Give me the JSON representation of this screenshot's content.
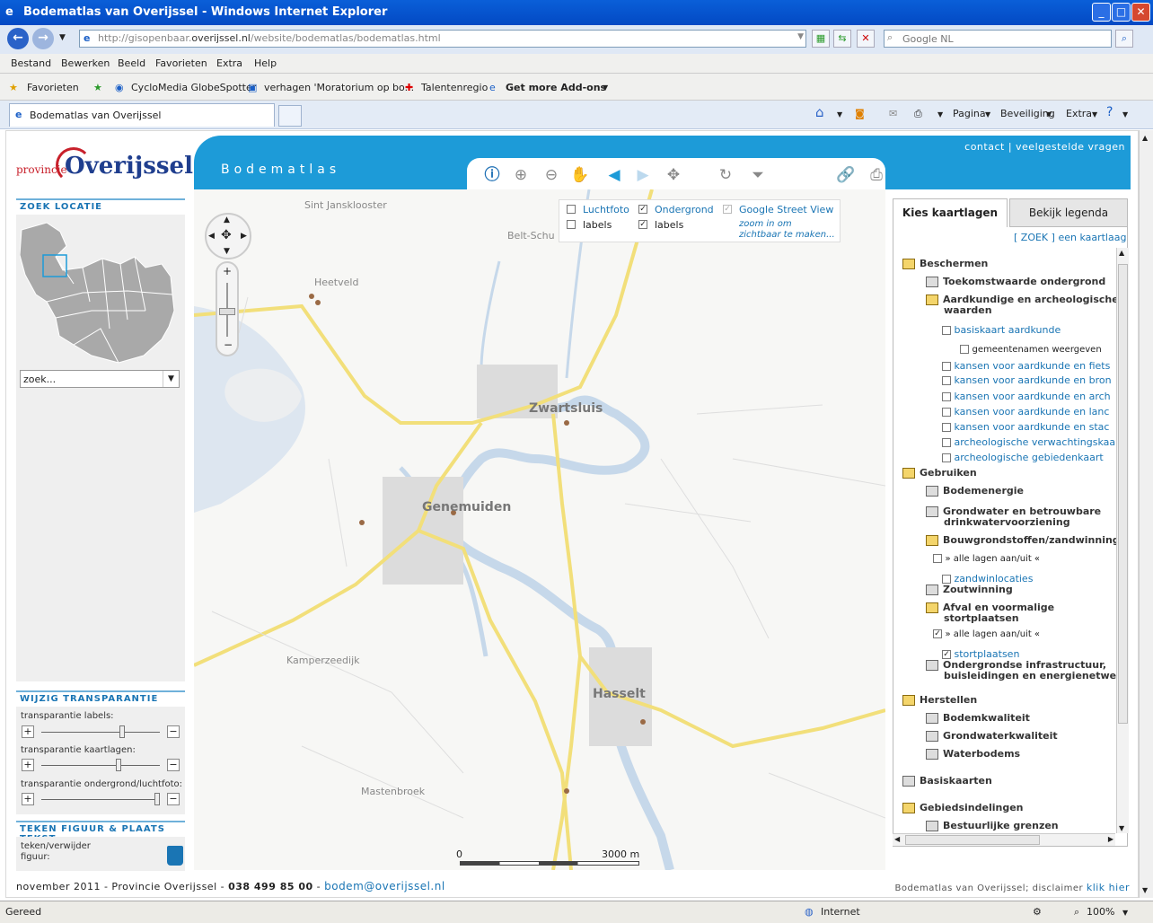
{
  "window": {
    "title": "Bodematlas van Overijssel - Windows Internet Explorer",
    "logo_glyph": "e"
  },
  "address": {
    "url_prefix": "http://gisopenbaar.",
    "url_host": "overijssel.nl",
    "url_suffix": "/website/bodematlas/bodematlas.html",
    "search_placeholder": "Google NL"
  },
  "menu": [
    "Bestand",
    "Bewerken",
    "Beeld",
    "Favorieten",
    "Extra",
    "Help"
  ],
  "favorites": {
    "label": "Favorieten",
    "items": [
      "CycloMedia GlobeSpotter",
      "verhagen 'Moratorium op bo...",
      "Talentenregio",
      "Get more Add-ons"
    ]
  },
  "tab": {
    "label": "Bodematlas van Overijssel"
  },
  "commands": {
    "pagina": "Pagina",
    "beveiliging": "Beveiliging",
    "extra": "Extra"
  },
  "logo": {
    "provincie": "provincie",
    "name": "Overijssel"
  },
  "left": {
    "zoek_title": "ZOEK LOCATIE",
    "zoek_value": "zoek...",
    "transp_title": "WIJZIG TRANSPARANTIE",
    "transp_labels": [
      "transparantie labels:",
      "transparantie kaartlagen:",
      "transparantie ondergrond/luchtfoto:"
    ],
    "transp_values": [
      0.68,
      0.65,
      0.98
    ],
    "teken_title": "TEKEN FIGUUR & PLAATS TEKST",
    "teken_label1": "teken/verwijder",
    "teken_label2": "figuur:"
  },
  "header": {
    "title": "Bodematlas",
    "contact": "contact",
    "sep": "|",
    "faq": "veelgestelde vragen"
  },
  "layers": {
    "luchtfoto": "Luchtfoto",
    "labels1": "labels",
    "ondergrond": "Ondergrond",
    "labels2": "labels",
    "streetview": "Google Street View",
    "zoom_note1": "zoom in om",
    "zoom_note2": "zichtbaar te maken..."
  },
  "map": {
    "places": [
      "Sint Jansklooster",
      "Belt-Schu",
      "Heetveld",
      "Zwartsluis",
      "Genemuiden",
      "Kamperzeedijk",
      "Hasselt",
      "Mastenbroek"
    ],
    "scale_start": "0",
    "scale_end": "3000 m"
  },
  "right": {
    "tab_active": "Kies kaartlagen",
    "tab_other": "Bekijk legenda",
    "zoek_link": "[ ZOEK ]",
    "zoek_text": "een kaartlaag...",
    "tree": [
      {
        "label": "Beschermen",
        "kind": "group-open"
      },
      {
        "label": "Toekomstwaarde ondergrond",
        "kind": "sub"
      },
      {
        "label": "Aardkundige en archeologische",
        "kind": "sub-open"
      },
      {
        "label": "waarden",
        "kind": "cont"
      },
      {
        "label": "basiskaart aardkunde",
        "kind": "layer"
      },
      {
        "label": "gemeentenamen weergeven",
        "kind": "sublayer"
      },
      {
        "label": "kansen voor aardkunde en fiets",
        "kind": "layer"
      },
      {
        "label": "kansen voor aardkunde en bron",
        "kind": "layer"
      },
      {
        "label": "kansen voor aardkunde en arch",
        "kind": "layer"
      },
      {
        "label": "kansen voor aardkunde en lanc",
        "kind": "layer"
      },
      {
        "label": "kansen voor aardkunde en stac",
        "kind": "layer"
      },
      {
        "label": "archeologische verwachtingskaa",
        "kind": "layer"
      },
      {
        "label": "archeologische gebiedenkaart",
        "kind": "layer"
      },
      {
        "label": "Gebruiken",
        "kind": "group-open"
      },
      {
        "label": "Bodemenergie",
        "kind": "sub"
      },
      {
        "label": "Grondwater en betrouwbare",
        "kind": "sub"
      },
      {
        "label": "drinkwatervoorziening",
        "kind": "cont"
      },
      {
        "label": "Bouwgrondstoffen/zandwinning",
        "kind": "sub-open"
      },
      {
        "label": "» alle lagen aan/uit «",
        "kind": "all"
      },
      {
        "label": "zandwinlocaties",
        "kind": "layer"
      },
      {
        "label": "Zoutwinning",
        "kind": "sub"
      },
      {
        "label": "Afval en voormalige",
        "kind": "sub-open"
      },
      {
        "label": "stortplaatsen",
        "kind": "cont"
      },
      {
        "label": "» alle lagen aan/uit «",
        "kind": "all-checked"
      },
      {
        "label": "stortplaatsen",
        "kind": "layer-checked"
      },
      {
        "label": "Ondergrondse infrastructuur,",
        "kind": "sub"
      },
      {
        "label": "buisleidingen en energienetwerken",
        "kind": "cont"
      },
      {
        "label": "Herstellen",
        "kind": "group-open"
      },
      {
        "label": "Bodemkwaliteit",
        "kind": "sub"
      },
      {
        "label": "Grondwaterkwaliteit",
        "kind": "sub"
      },
      {
        "label": "Waterbodems",
        "kind": "sub"
      },
      {
        "label": "Basiskaarten",
        "kind": "group"
      },
      {
        "label": "Gebiedsindelingen",
        "kind": "group-open"
      },
      {
        "label": "Bestuurlijke grenzen",
        "kind": "sub"
      }
    ]
  },
  "footer": {
    "left": "november 2011 - Provincie Overijssel - ",
    "phone": "038 499 85 00",
    "dash": " - ",
    "email": "bodem@overijssel.nl",
    "right_text": "Bodematlas van Overijssel; disclaimer ",
    "right_link": "klik hier"
  },
  "status": {
    "left": "Gereed",
    "zone": "Internet",
    "zoom": "100%"
  }
}
